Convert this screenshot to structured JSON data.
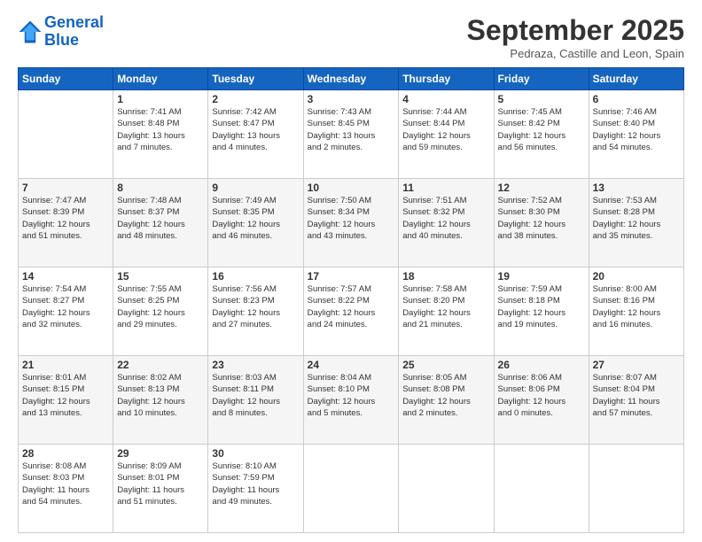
{
  "logo": {
    "line1": "General",
    "line2": "Blue"
  },
  "header": {
    "month_title": "September 2025",
    "subtitle": "Pedraza, Castille and Leon, Spain"
  },
  "weekdays": [
    "Sunday",
    "Monday",
    "Tuesday",
    "Wednesday",
    "Thursday",
    "Friday",
    "Saturday"
  ],
  "weeks": [
    [
      {
        "day": "",
        "info": ""
      },
      {
        "day": "1",
        "info": "Sunrise: 7:41 AM\nSunset: 8:48 PM\nDaylight: 13 hours\nand 7 minutes."
      },
      {
        "day": "2",
        "info": "Sunrise: 7:42 AM\nSunset: 8:47 PM\nDaylight: 13 hours\nand 4 minutes."
      },
      {
        "day": "3",
        "info": "Sunrise: 7:43 AM\nSunset: 8:45 PM\nDaylight: 13 hours\nand 2 minutes."
      },
      {
        "day": "4",
        "info": "Sunrise: 7:44 AM\nSunset: 8:44 PM\nDaylight: 12 hours\nand 59 minutes."
      },
      {
        "day": "5",
        "info": "Sunrise: 7:45 AM\nSunset: 8:42 PM\nDaylight: 12 hours\nand 56 minutes."
      },
      {
        "day": "6",
        "info": "Sunrise: 7:46 AM\nSunset: 8:40 PM\nDaylight: 12 hours\nand 54 minutes."
      }
    ],
    [
      {
        "day": "7",
        "info": "Sunrise: 7:47 AM\nSunset: 8:39 PM\nDaylight: 12 hours\nand 51 minutes."
      },
      {
        "day": "8",
        "info": "Sunrise: 7:48 AM\nSunset: 8:37 PM\nDaylight: 12 hours\nand 48 minutes."
      },
      {
        "day": "9",
        "info": "Sunrise: 7:49 AM\nSunset: 8:35 PM\nDaylight: 12 hours\nand 46 minutes."
      },
      {
        "day": "10",
        "info": "Sunrise: 7:50 AM\nSunset: 8:34 PM\nDaylight: 12 hours\nand 43 minutes."
      },
      {
        "day": "11",
        "info": "Sunrise: 7:51 AM\nSunset: 8:32 PM\nDaylight: 12 hours\nand 40 minutes."
      },
      {
        "day": "12",
        "info": "Sunrise: 7:52 AM\nSunset: 8:30 PM\nDaylight: 12 hours\nand 38 minutes."
      },
      {
        "day": "13",
        "info": "Sunrise: 7:53 AM\nSunset: 8:28 PM\nDaylight: 12 hours\nand 35 minutes."
      }
    ],
    [
      {
        "day": "14",
        "info": "Sunrise: 7:54 AM\nSunset: 8:27 PM\nDaylight: 12 hours\nand 32 minutes."
      },
      {
        "day": "15",
        "info": "Sunrise: 7:55 AM\nSunset: 8:25 PM\nDaylight: 12 hours\nand 29 minutes."
      },
      {
        "day": "16",
        "info": "Sunrise: 7:56 AM\nSunset: 8:23 PM\nDaylight: 12 hours\nand 27 minutes."
      },
      {
        "day": "17",
        "info": "Sunrise: 7:57 AM\nSunset: 8:22 PM\nDaylight: 12 hours\nand 24 minutes."
      },
      {
        "day": "18",
        "info": "Sunrise: 7:58 AM\nSunset: 8:20 PM\nDaylight: 12 hours\nand 21 minutes."
      },
      {
        "day": "19",
        "info": "Sunrise: 7:59 AM\nSunset: 8:18 PM\nDaylight: 12 hours\nand 19 minutes."
      },
      {
        "day": "20",
        "info": "Sunrise: 8:00 AM\nSunset: 8:16 PM\nDaylight: 12 hours\nand 16 minutes."
      }
    ],
    [
      {
        "day": "21",
        "info": "Sunrise: 8:01 AM\nSunset: 8:15 PM\nDaylight: 12 hours\nand 13 minutes."
      },
      {
        "day": "22",
        "info": "Sunrise: 8:02 AM\nSunset: 8:13 PM\nDaylight: 12 hours\nand 10 minutes."
      },
      {
        "day": "23",
        "info": "Sunrise: 8:03 AM\nSunset: 8:11 PM\nDaylight: 12 hours\nand 8 minutes."
      },
      {
        "day": "24",
        "info": "Sunrise: 8:04 AM\nSunset: 8:10 PM\nDaylight: 12 hours\nand 5 minutes."
      },
      {
        "day": "25",
        "info": "Sunrise: 8:05 AM\nSunset: 8:08 PM\nDaylight: 12 hours\nand 2 minutes."
      },
      {
        "day": "26",
        "info": "Sunrise: 8:06 AM\nSunset: 8:06 PM\nDaylight: 12 hours\nand 0 minutes."
      },
      {
        "day": "27",
        "info": "Sunrise: 8:07 AM\nSunset: 8:04 PM\nDaylight: 11 hours\nand 57 minutes."
      }
    ],
    [
      {
        "day": "28",
        "info": "Sunrise: 8:08 AM\nSunset: 8:03 PM\nDaylight: 11 hours\nand 54 minutes."
      },
      {
        "day": "29",
        "info": "Sunrise: 8:09 AM\nSunset: 8:01 PM\nDaylight: 11 hours\nand 51 minutes."
      },
      {
        "day": "30",
        "info": "Sunrise: 8:10 AM\nSunset: 7:59 PM\nDaylight: 11 hours\nand 49 minutes."
      },
      {
        "day": "",
        "info": ""
      },
      {
        "day": "",
        "info": ""
      },
      {
        "day": "",
        "info": ""
      },
      {
        "day": "",
        "info": ""
      }
    ]
  ]
}
